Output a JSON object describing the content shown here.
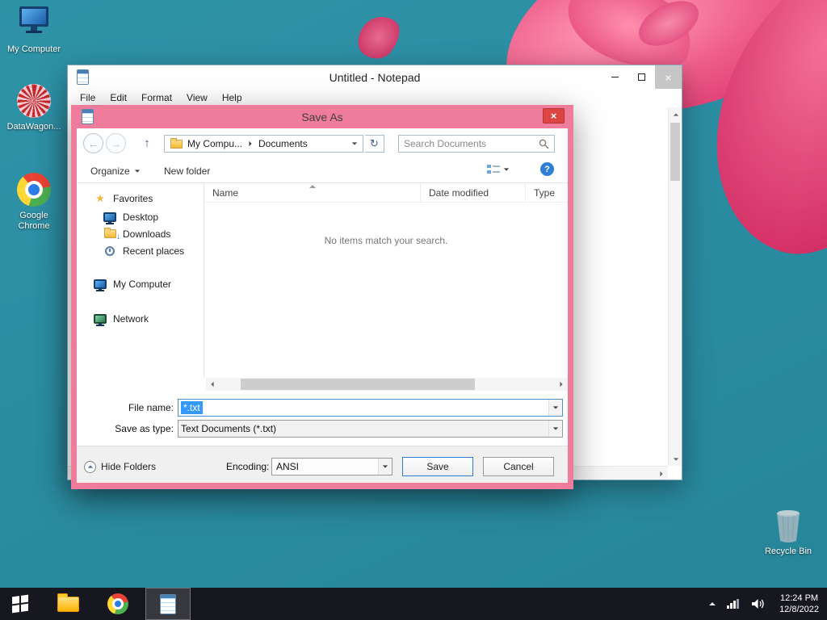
{
  "desktop": {
    "icons": [
      {
        "label": "My Computer"
      },
      {
        "label": "DataWagon..."
      },
      {
        "label": "Google Chrome"
      },
      {
        "label": "Recycle Bin"
      }
    ]
  },
  "notepad": {
    "title": "Untitled - Notepad",
    "menu": [
      "File",
      "Edit",
      "Format",
      "View",
      "Help"
    ]
  },
  "dialog": {
    "title": "Save As",
    "nav": {
      "breadcrumb_root": "My Compu...",
      "breadcrumb_folder": "Documents",
      "search_placeholder": "Search Documents"
    },
    "toolbar": {
      "organize": "Organize",
      "new_folder": "New folder"
    },
    "sidebar": {
      "favorites": "Favorites",
      "items": [
        {
          "label": "Desktop"
        },
        {
          "label": "Downloads"
        },
        {
          "label": "Recent places"
        }
      ],
      "computer": "My Computer",
      "network": "Network"
    },
    "list": {
      "columns": [
        "Name",
        "Date modified",
        "Type"
      ],
      "empty": "No items match your search."
    },
    "fields": {
      "file_name_label": "File name:",
      "file_name_value": "*.txt",
      "save_type_label": "Save as type:",
      "save_type_value": "Text Documents (*.txt)"
    },
    "footer": {
      "hide_folders": "Hide Folders",
      "encoding_label": "Encoding:",
      "encoding_value": "ANSI",
      "save": "Save",
      "cancel": "Cancel"
    }
  },
  "taskbar": {
    "time": "12:24 PM",
    "date": "12/8/2022"
  },
  "icons": {
    "back": "←",
    "forward": "→",
    "up": "↑",
    "refresh": "↻",
    "download_arrow": "↓",
    "help": "?",
    "close": "×"
  },
  "colors": {
    "desktop": "#2e8ca0",
    "dialog_chrome": "#f07c9c",
    "close_button": "#dd4444",
    "selection": "#3399ff",
    "taskbar": "#17171f"
  }
}
